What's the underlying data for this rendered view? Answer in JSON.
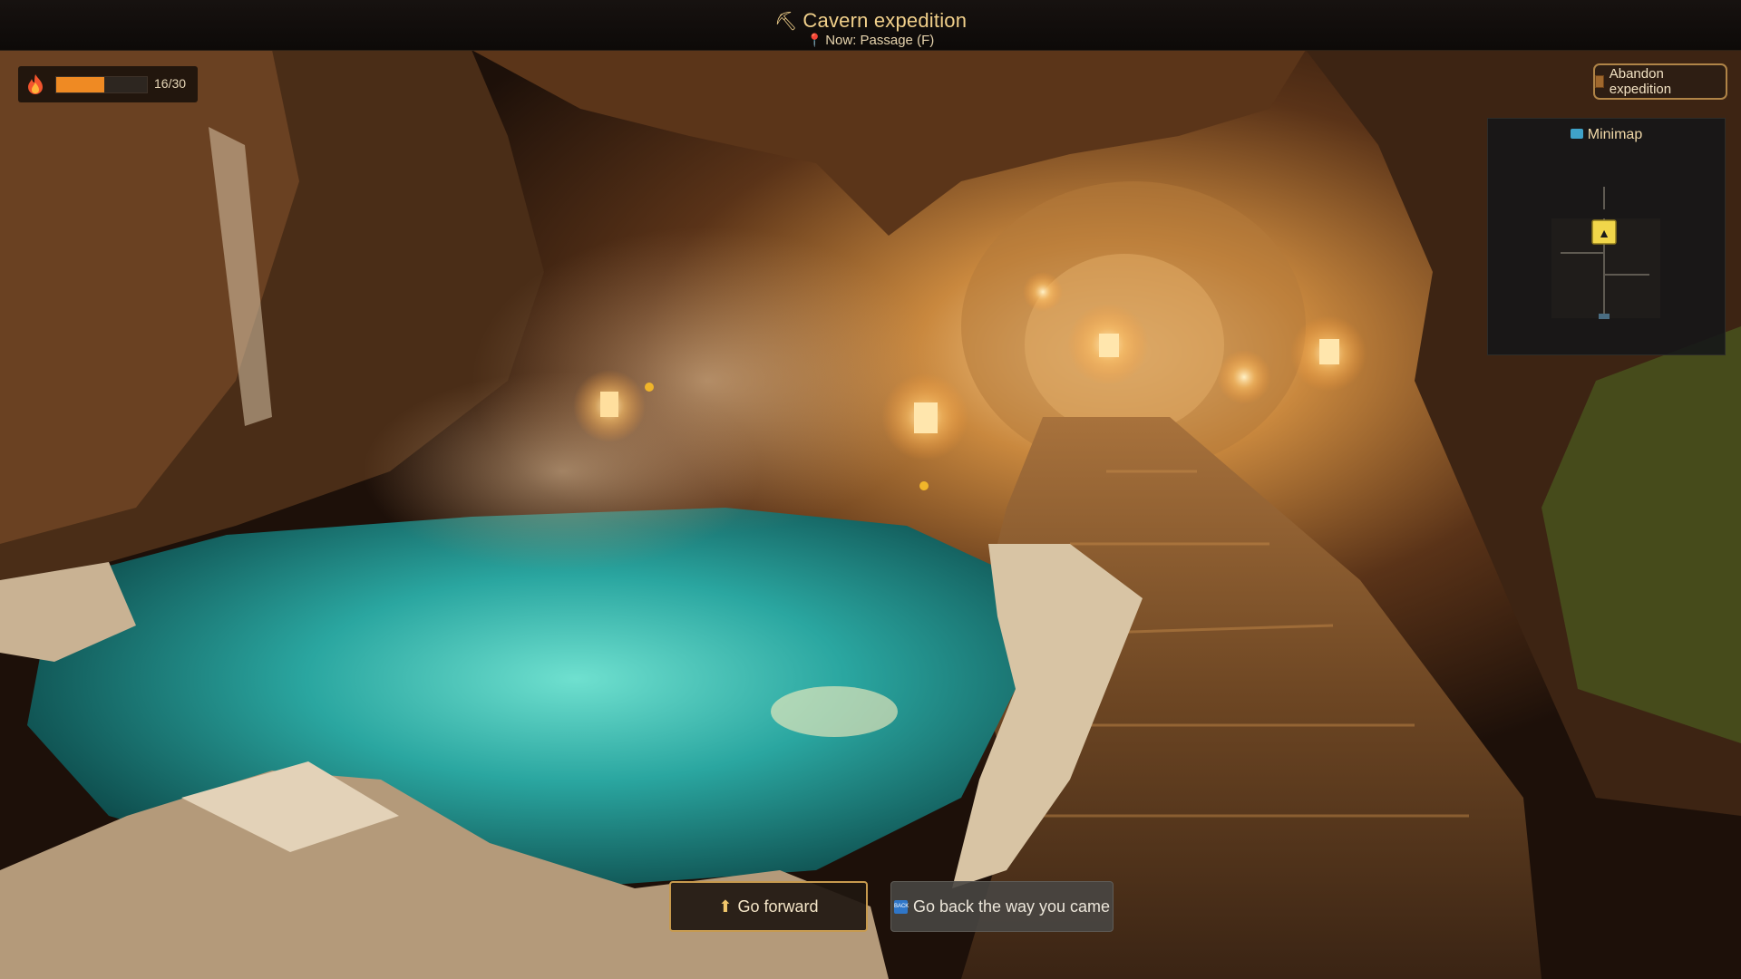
{
  "header": {
    "title": "Cavern expedition",
    "title_icon": "pickaxe-icon",
    "location": "Now: Passage (F)",
    "location_icon": "pin-icon"
  },
  "torch": {
    "icon": "flame-icon",
    "current": 16,
    "max": 30,
    "label": "16/30",
    "fill_fraction": 0.5333,
    "fill_color": "#ef8a23"
  },
  "actions": {
    "abandon_label": "Abandon expedition",
    "forward_label": "Go forward",
    "back_label": "Go back the way you came"
  },
  "minimap": {
    "title": "Minimap",
    "player_marker": "▲"
  },
  "colors": {
    "accent": "#f0cf8a",
    "button_border": "#c79a4e",
    "torch_fill": "#ef8a23",
    "pool": "#2aa6a0"
  }
}
